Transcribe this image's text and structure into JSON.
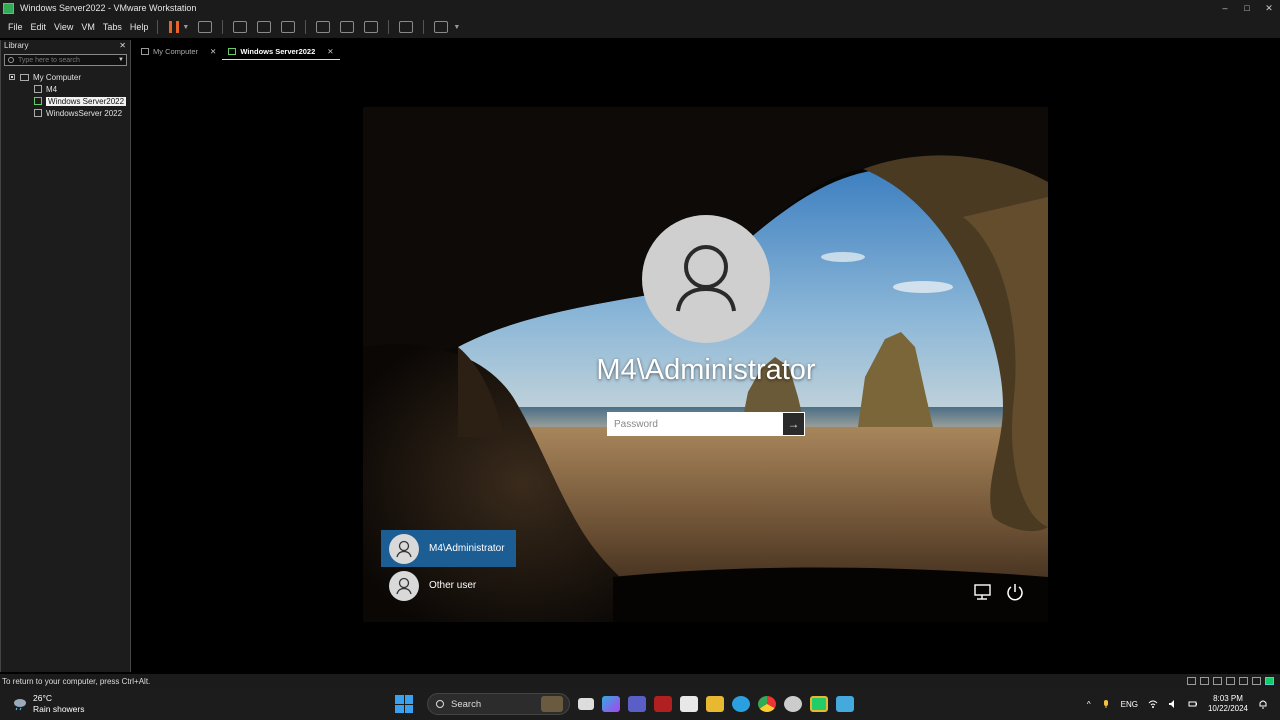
{
  "window": {
    "title": "Windows Server2022 - VMware Workstation",
    "controls": [
      "–",
      "□",
      "✕"
    ]
  },
  "menu": [
    "File",
    "Edit",
    "View",
    "VM",
    "Tabs",
    "Help"
  ],
  "library": {
    "title": "Library",
    "close": "✕",
    "search_placeholder": "Type here to search",
    "root": "My Computer",
    "items": [
      "M4",
      "Windows Server2022",
      "WindowsServer 2022"
    ],
    "selected_index": 1
  },
  "tabs": [
    {
      "label": "My Computer",
      "active": false
    },
    {
      "label": "Windows Server2022",
      "active": true
    }
  ],
  "tab_close": "✕",
  "login": {
    "username": "M4\\Administrator",
    "password_placeholder": "Password",
    "submit_glyph": "→"
  },
  "users": [
    {
      "name": "M4\\Administrator",
      "active": true
    },
    {
      "name": "Other user",
      "active": false
    }
  ],
  "statusbar": {
    "hint": "To return to your computer, press Ctrl+Alt."
  },
  "taskbar": {
    "weather_temp": "26°C",
    "weather_desc": "Rain showers",
    "search_label": "Search",
    "language": "ENG",
    "time": "8:03 PM",
    "date": "10/22/2024",
    "tray_chevron": "^"
  },
  "colors": {
    "selected_user_bg": "#1c5d93",
    "pause_accent": "#e8652a",
    "start_blue": "#3aa0f0"
  }
}
